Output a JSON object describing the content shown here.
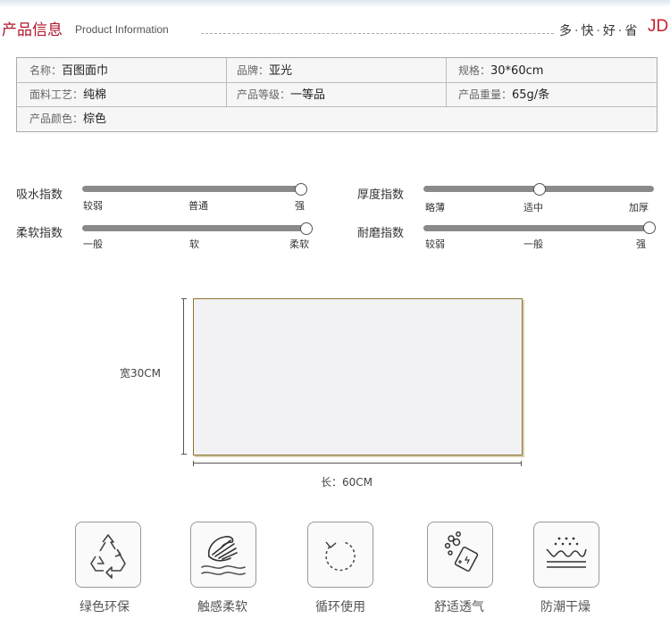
{
  "header": {
    "title": "产品信息",
    "subtitle": "Product Information",
    "slogan": [
      "多",
      "快",
      "好",
      "省"
    ],
    "brand": "JD"
  },
  "info_table": {
    "rows": [
      [
        {
          "key": "名称：",
          "value": "百图面巾"
        },
        {
          "key": "品牌：",
          "value": "亚光"
        },
        {
          "key": "规格：",
          "value": "30*60cm"
        }
      ],
      [
        {
          "key": "面料工艺：",
          "value": "纯棉"
        },
        {
          "key": "产品等级：",
          "value": "一等品"
        },
        {
          "key": "产品重量：",
          "value": "65g/条"
        }
      ],
      [
        {
          "key": "产品颜色：",
          "value": "棕色"
        }
      ]
    ]
  },
  "indices": [
    {
      "label": "吸水指数",
      "ticks": [
        "较弱",
        "普通",
        "强"
      ],
      "level": 1.0
    },
    {
      "label": "厚度指数",
      "ticks": [
        "略薄",
        "适中",
        "加厚"
      ],
      "level": 0.5
    },
    {
      "label": "柔软指数",
      "ticks": [
        "一般",
        "软",
        "柔软"
      ],
      "level": 1.0
    },
    {
      "label": "耐磨指数",
      "ticks": [
        "较弱",
        "一般",
        "强"
      ],
      "level": 1.0
    }
  ],
  "diagram": {
    "width_label": "宽30CM",
    "length_label": "长：60CM"
  },
  "features": [
    {
      "label": "绿色环保",
      "icon": "recycle-icon"
    },
    {
      "label": "触感柔软",
      "icon": "hand-touch-icon"
    },
    {
      "label": "循环使用",
      "icon": "cycle-arrow-icon"
    },
    {
      "label": "舒适透气",
      "icon": "breathable-icon"
    },
    {
      "label": "防潮干燥",
      "icon": "moisture-proof-icon"
    }
  ],
  "colors": {
    "accent": "#b0142b",
    "brand": "#c9202c",
    "track": "#8a8a8a",
    "towel_border": "#8a7430"
  }
}
